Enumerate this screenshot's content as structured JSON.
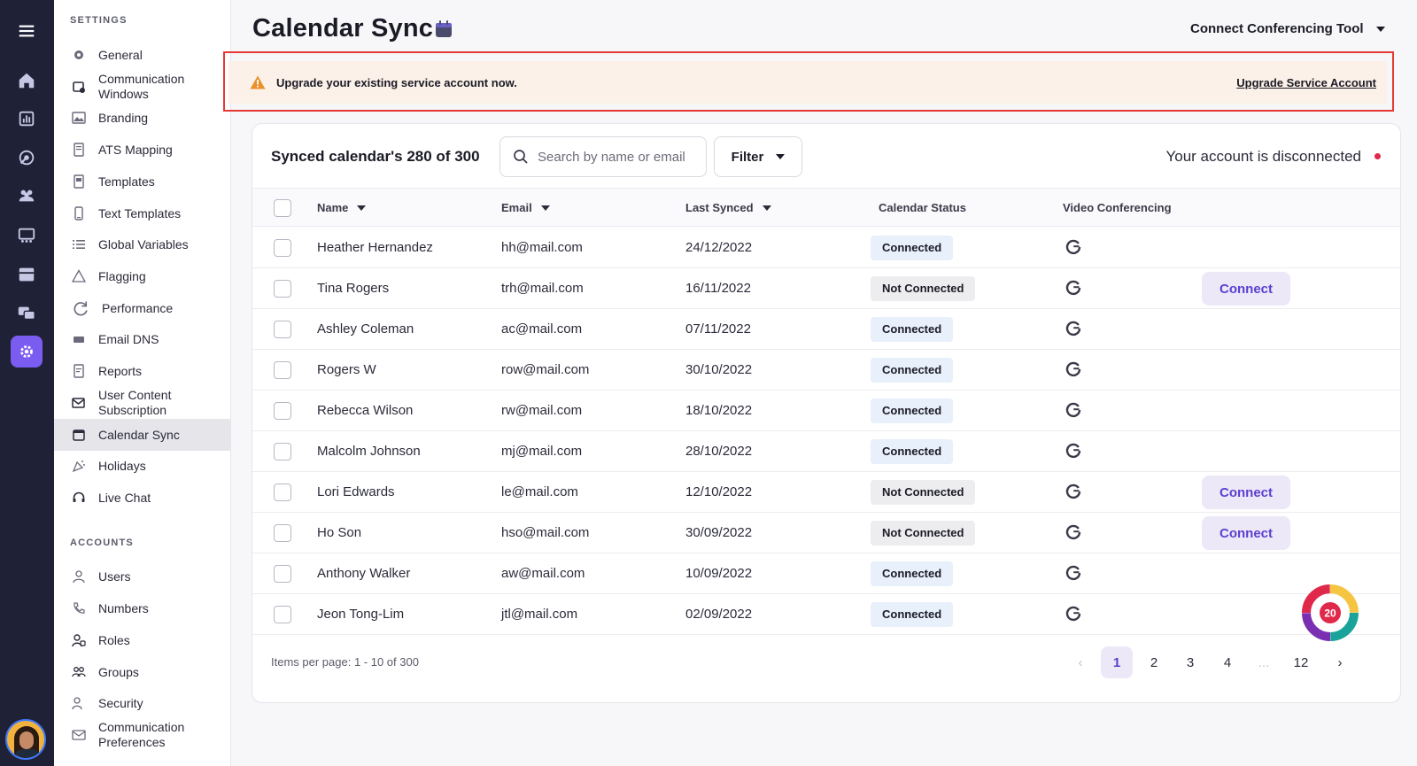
{
  "rail": {
    "items": [
      "menu-icon",
      "home-icon",
      "analytics-icon",
      "campaign-icon",
      "people-icon",
      "board-icon",
      "inbox-icon",
      "chat-icon",
      "settings-icon"
    ]
  },
  "sidebar": {
    "settings_label": "SETTINGS",
    "accounts_label": "ACCOUNTS",
    "items": [
      {
        "label": "General"
      },
      {
        "label": "Communication Windows"
      },
      {
        "label": "Branding"
      },
      {
        "label": "ATS Mapping"
      },
      {
        "label": "Templates"
      },
      {
        "label": "Text Templates"
      },
      {
        "label": "Global Variables"
      },
      {
        "label": "Flagging"
      },
      {
        "label": "Performance"
      },
      {
        "label": "Email DNS"
      },
      {
        "label": "Reports"
      },
      {
        "label": "User Content Subscription"
      },
      {
        "label": "Calendar Sync"
      },
      {
        "label": "Holidays"
      },
      {
        "label": "Live Chat"
      }
    ],
    "account_items": [
      {
        "label": "Users"
      },
      {
        "label": "Numbers"
      },
      {
        "label": "Roles"
      },
      {
        "label": "Groups"
      },
      {
        "label": "Security"
      },
      {
        "label": "Communication Preferences"
      }
    ]
  },
  "header": {
    "title": "Calendar Sync",
    "conferencing_tool": "Connect Conferencing Tool"
  },
  "banner": {
    "message": "Upgrade your existing service account now.",
    "link": "Upgrade Service Account"
  },
  "card": {
    "title": "Synced calendar's 280 of 300",
    "search_placeholder": "Search by name or email",
    "filter_label": "Filter",
    "account_status": "Your account is disconnected"
  },
  "table": {
    "columns": {
      "name": "Name",
      "email": "Email",
      "last_synced": "Last Synced",
      "calendar_status": "Calendar Status",
      "video_conferencing": "Video Conferencing"
    },
    "connect_label": "Connect",
    "rows": [
      {
        "name": "Heather Hernandez",
        "email": "hh@mail.com",
        "date": "24/12/2022",
        "status": "Connected",
        "connect": false
      },
      {
        "name": "Tina Rogers",
        "email": "trh@mail.com",
        "date": "16/11/2022",
        "status": "Not Connected",
        "connect": true
      },
      {
        "name": "Ashley Coleman",
        "email": "ac@mail.com",
        "date": "07/11/2022",
        "status": "Connected",
        "connect": false
      },
      {
        "name": "Rogers W",
        "email": "row@mail.com",
        "date": "30/10/2022",
        "status": "Connected",
        "connect": false
      },
      {
        "name": "Rebecca Wilson",
        "email": "rw@mail.com",
        "date": "18/10/2022",
        "status": "Connected",
        "connect": false
      },
      {
        "name": "Malcolm Johnson",
        "email": "mj@mail.com",
        "date": "28/10/2022",
        "status": "Connected",
        "connect": false
      },
      {
        "name": "Lori Edwards",
        "email": "le@mail.com",
        "date": "12/10/2022",
        "status": "Not Connected",
        "connect": true
      },
      {
        "name": "Ho Son",
        "email": "hso@mail.com",
        "date": "30/09/2022",
        "status": "Not Connected",
        "connect": true
      },
      {
        "name": "Anthony Walker",
        "email": "aw@mail.com",
        "date": "10/09/2022",
        "status": "Connected",
        "connect": false
      },
      {
        "name": "Jeon Tong-Lim",
        "email": "jtl@mail.com",
        "date": "02/09/2022",
        "status": "Connected",
        "connect": false
      }
    ]
  },
  "footer": {
    "items_per_page": "Items per page: 1 - 10 of 300",
    "pages": [
      "1",
      "2",
      "3",
      "4",
      "...",
      "12"
    ],
    "current_page": "1"
  },
  "widget": {
    "count": "20"
  },
  "colors": {
    "accent": "#7b5cf0",
    "rail_bg": "#1f2236",
    "banner_bg": "#fbf1e8",
    "banner_highlight": "#e53935",
    "connected_badge": "#e7f0fb",
    "not_connected_badge": "#ededf0",
    "disconnected_dot": "#e0284a"
  }
}
